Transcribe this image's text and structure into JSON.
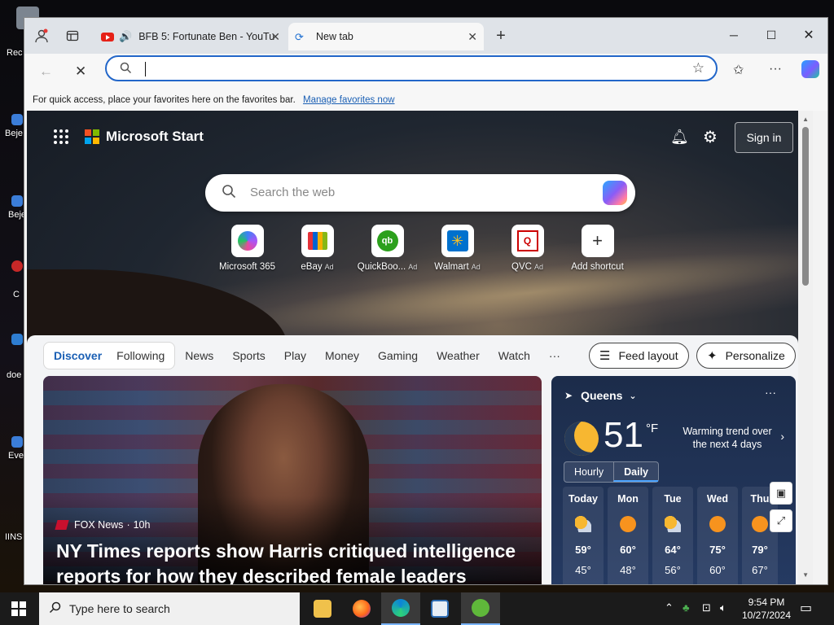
{
  "browser": {
    "tabs": [
      {
        "title": "BFB 5: Fortunate Ben - YouTu"
      },
      {
        "title": "New tab"
      }
    ],
    "address": {
      "value": ""
    },
    "favbar": {
      "text": "For quick access, place your favorites here on the favorites bar.",
      "link": "Manage favorites now"
    }
  },
  "start_page": {
    "brand": "Microsoft Start",
    "sign_in": "Sign in",
    "search_placeholder": "Search the web",
    "shortcuts": [
      {
        "label": "Microsoft 365",
        "ad": ""
      },
      {
        "label": "eBay",
        "ad": "Ad"
      },
      {
        "label": "QuickBoo...",
        "ad": "Ad"
      },
      {
        "label": "Walmart",
        "ad": "Ad"
      },
      {
        "label": "QVC",
        "ad": "Ad"
      },
      {
        "label": "Add shortcut",
        "ad": ""
      }
    ],
    "feed_tabs": {
      "discover": "Discover",
      "following": "Following"
    },
    "nav_links": [
      "News",
      "Sports",
      "Play",
      "Money",
      "Gaming",
      "Weather",
      "Watch",
      "···"
    ],
    "feed_layout": "Feed layout",
    "personalize": "Personalize",
    "news": {
      "source": "FOX News",
      "age": "10h",
      "title": "NY Times reports show Harris critiqued intelligence reports for how they described female leaders"
    },
    "weather": {
      "location": "Queens",
      "temp": "51",
      "unit": "°F",
      "trend": "Warming trend over the next 4 days",
      "tabs": [
        "Hourly",
        "Daily"
      ],
      "days": [
        {
          "name": "Today",
          "hi": "59°",
          "lo": "45°",
          "icon": "partly-cloudy-icon"
        },
        {
          "name": "Mon",
          "hi": "60°",
          "lo": "48°",
          "icon": "sunny-icon"
        },
        {
          "name": "Tue",
          "hi": "64°",
          "lo": "56°",
          "icon": "partly-cloudy-icon"
        },
        {
          "name": "Wed",
          "hi": "75°",
          "lo": "60°",
          "icon": "sunny-icon"
        },
        {
          "name": "Thu",
          "hi": "79°",
          "lo": "67°",
          "icon": "sunny-icon"
        }
      ]
    }
  },
  "taskbar": {
    "search_placeholder": "Type here to search",
    "time": "9:54 PM",
    "date": "10/27/2024"
  },
  "desktop_labels": [
    "Rec",
    "Beje",
    "Beje",
    "C",
    "doe",
    "Eve",
    "IINS"
  ]
}
